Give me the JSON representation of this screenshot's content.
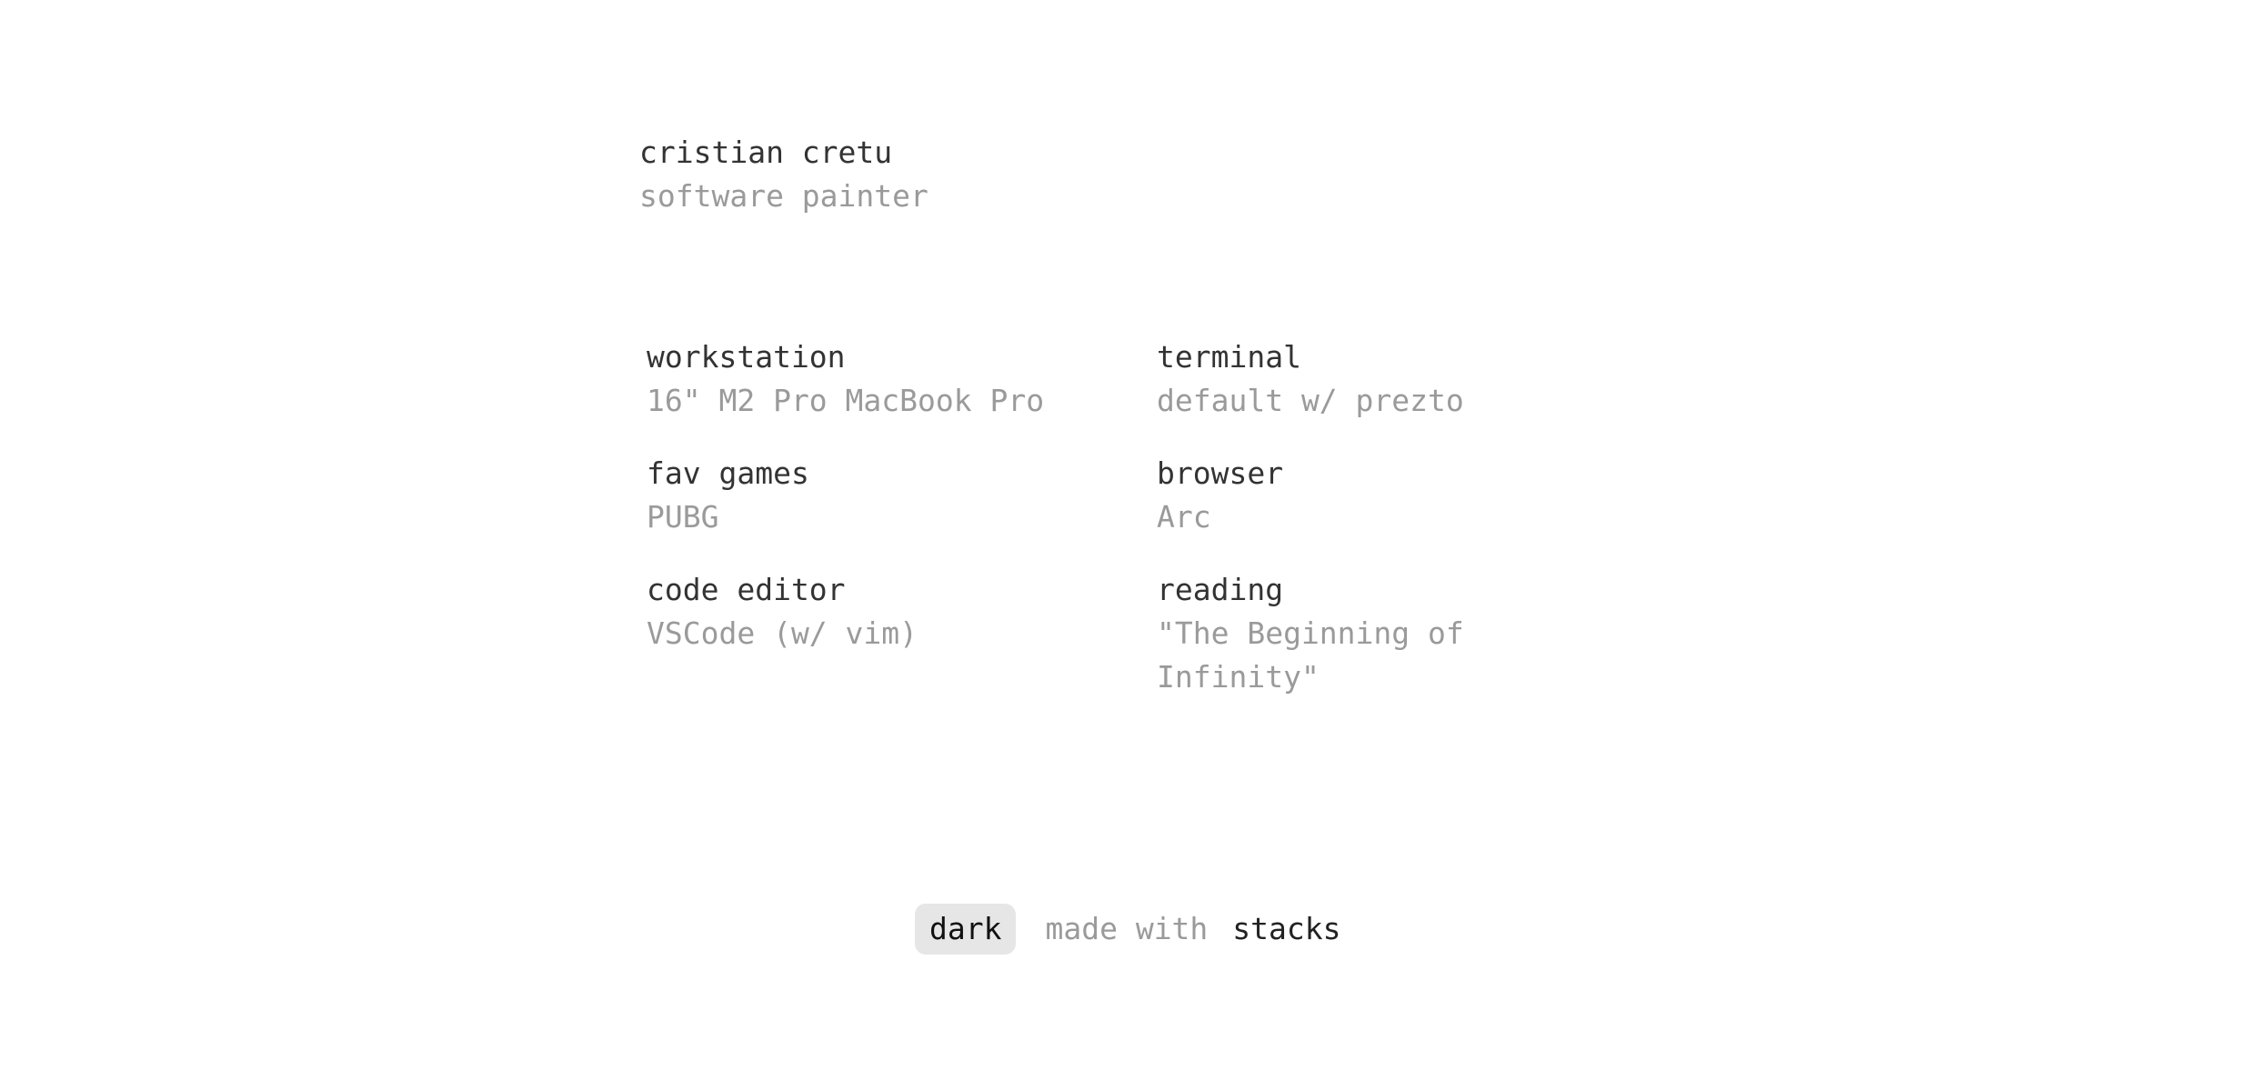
{
  "profile": {
    "name": "cristian cretu",
    "tagline": "software painter"
  },
  "items": [
    {
      "label": "workstation",
      "value": "16\" M2 Pro MacBook Pro"
    },
    {
      "label": "terminal",
      "value": "default w/ prezto"
    },
    {
      "label": "fav games",
      "value": "PUBG"
    },
    {
      "label": "browser",
      "value": "Arc"
    },
    {
      "label": "code editor",
      "value": "VSCode (w/ vim)"
    },
    {
      "label": "reading",
      "value": "\"The Beginning of Infinity\""
    }
  ],
  "footer": {
    "theme_toggle_label": "dark",
    "made_with": "made with",
    "link_label": "stacks"
  },
  "colors": {
    "primary_text": "#333333",
    "secondary_text": "#9a9a9a",
    "toggle_background": "#e6e6e6",
    "background": "#ffffff"
  }
}
